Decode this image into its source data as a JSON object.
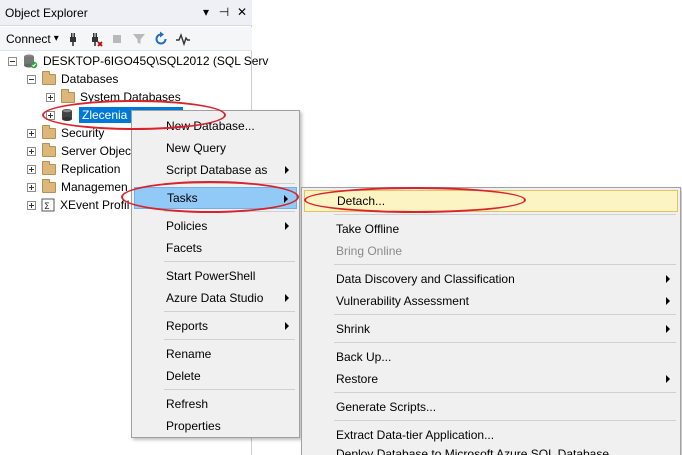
{
  "panel": {
    "title": "Object Explorer",
    "title_buttons": [
      "▾",
      "⊣",
      "✕"
    ]
  },
  "toolbar": {
    "connect_label": "Connect",
    "connect_arrow": "▾",
    "icons": [
      "connect-plug-icon",
      "disconnect-plug-icon",
      "stop-icon",
      "filter-icon",
      "refresh-icon",
      "activity-icon"
    ]
  },
  "tree": {
    "server": "DESKTOP-6IGO45Q\\SQL2012 (SQL Serv",
    "databases": "Databases",
    "system_databases": "System Databases",
    "selected_db": "Zlecenia",
    "security": "Security",
    "server_objects": "Server Object",
    "replication": "Replication",
    "management": "Managemen",
    "xevent": "XEvent Profil"
  },
  "context_menu": {
    "items": [
      {
        "label": "New Database...",
        "has_submenu": false
      },
      {
        "label": "New Query",
        "has_submenu": false
      },
      {
        "label": "Script Database as",
        "has_submenu": true
      },
      {
        "label": "Tasks",
        "has_submenu": true
      },
      {
        "label": "Policies",
        "has_submenu": true
      },
      {
        "label": "Facets",
        "has_submenu": false
      },
      {
        "label": "Start PowerShell",
        "has_submenu": false
      },
      {
        "label": "Azure Data Studio",
        "has_submenu": true
      },
      {
        "label": "Reports",
        "has_submenu": true
      },
      {
        "label": "Rename",
        "has_submenu": false
      },
      {
        "label": "Delete",
        "has_submenu": false
      },
      {
        "label": "Refresh",
        "has_submenu": false
      },
      {
        "label": "Properties",
        "has_submenu": false
      }
    ]
  },
  "tasks_menu": {
    "items": [
      {
        "label": "Detach...",
        "has_submenu": false
      },
      {
        "label": "Take Offline",
        "has_submenu": false
      },
      {
        "label": "Bring Online",
        "has_submenu": false,
        "disabled": true
      },
      {
        "label": "Data Discovery and Classification",
        "has_submenu": true
      },
      {
        "label": "Vulnerability Assessment",
        "has_submenu": true
      },
      {
        "label": "Shrink",
        "has_submenu": true
      },
      {
        "label": "Back Up...",
        "has_submenu": false
      },
      {
        "label": "Restore",
        "has_submenu": true
      },
      {
        "label": "Generate Scripts...",
        "has_submenu": false
      },
      {
        "label": "Extract Data-tier Application...",
        "has_submenu": false
      },
      {
        "label": "Deploy Database to Microsoft Azure SQL Database...",
        "has_submenu": false
      }
    ]
  },
  "colors": {
    "annotation": "#d9222a",
    "selection": "#0078d7",
    "menu_hover": "#91c9f7",
    "submenu_hover": "#fdf4c3"
  }
}
